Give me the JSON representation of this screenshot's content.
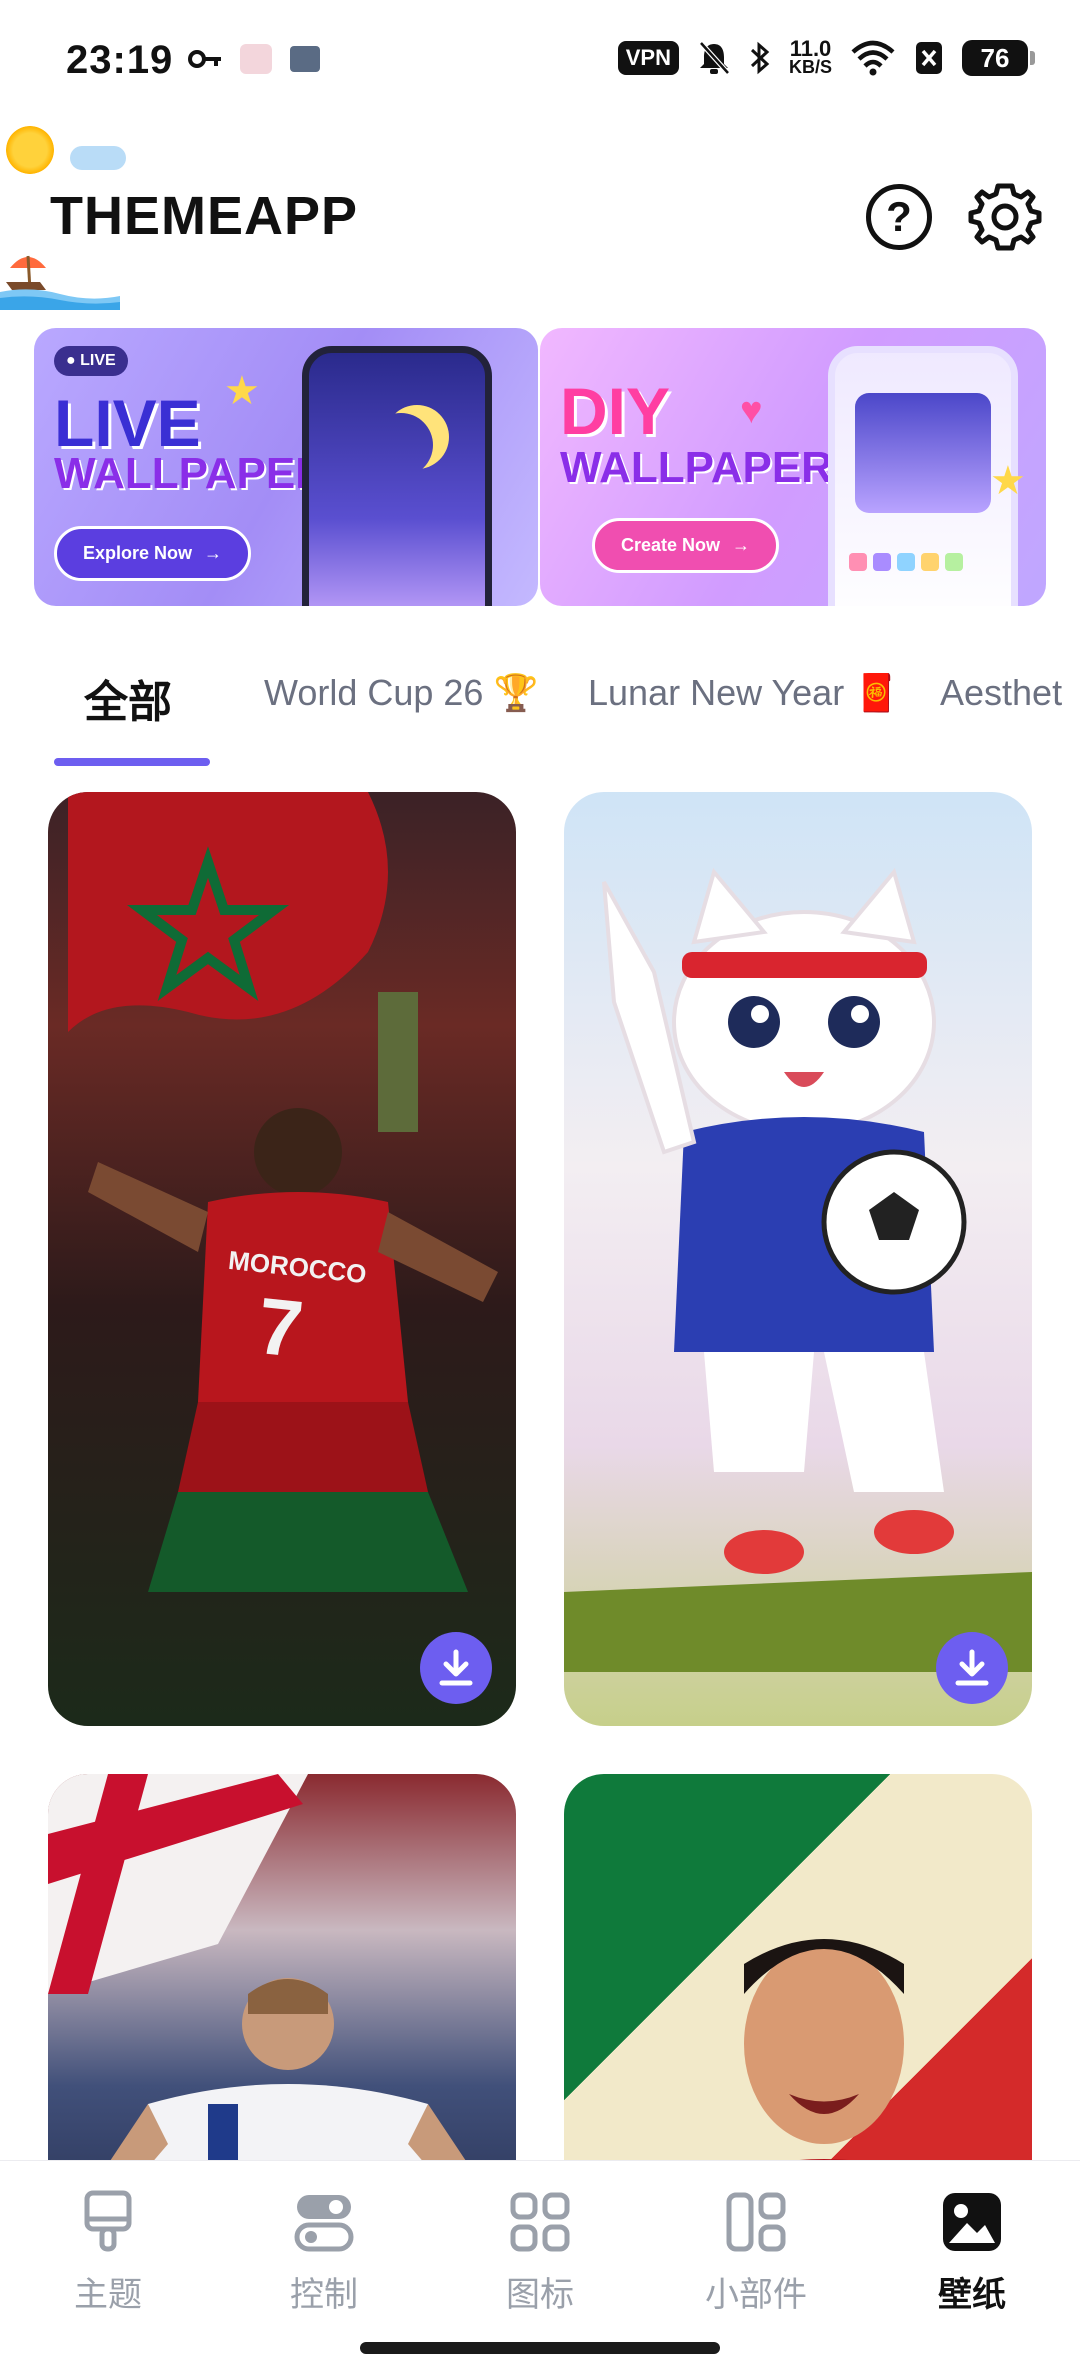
{
  "status_bar": {
    "time": "23:19",
    "vpn": "VPN",
    "speed_value": "11.0",
    "speed_unit": "KB/S",
    "battery": "76"
  },
  "header": {
    "title": "THEMEAPP",
    "help_glyph": "?"
  },
  "banners": {
    "live": {
      "pill": "LIVE",
      "title1": "LIVE",
      "title2": "WALLPAPER",
      "button": "Explore Now"
    },
    "diy": {
      "title1": "DIY",
      "title2": "WALLPAPER",
      "button": "Create Now"
    }
  },
  "tabs": [
    {
      "label": "全部",
      "active": true
    },
    {
      "label": "World Cup 26 🏆"
    },
    {
      "label": "Lunar New Year 🧧"
    },
    {
      "label": "Aesthet"
    }
  ],
  "wallpapers": {
    "card1_text": "MOROCCO",
    "card1_number": "7"
  },
  "bottom_nav": [
    {
      "label": "主题",
      "icon": "brush-icon"
    },
    {
      "label": "控制",
      "icon": "toggle-icon"
    },
    {
      "label": "图标",
      "icon": "grid-icon"
    },
    {
      "label": "小部件",
      "icon": "widget-icon"
    },
    {
      "label": "壁纸",
      "icon": "wallpaper-icon",
      "active": true
    }
  ],
  "colors": {
    "accent": "#6d5ef0",
    "nav_inactive": "#9aa0aa"
  }
}
